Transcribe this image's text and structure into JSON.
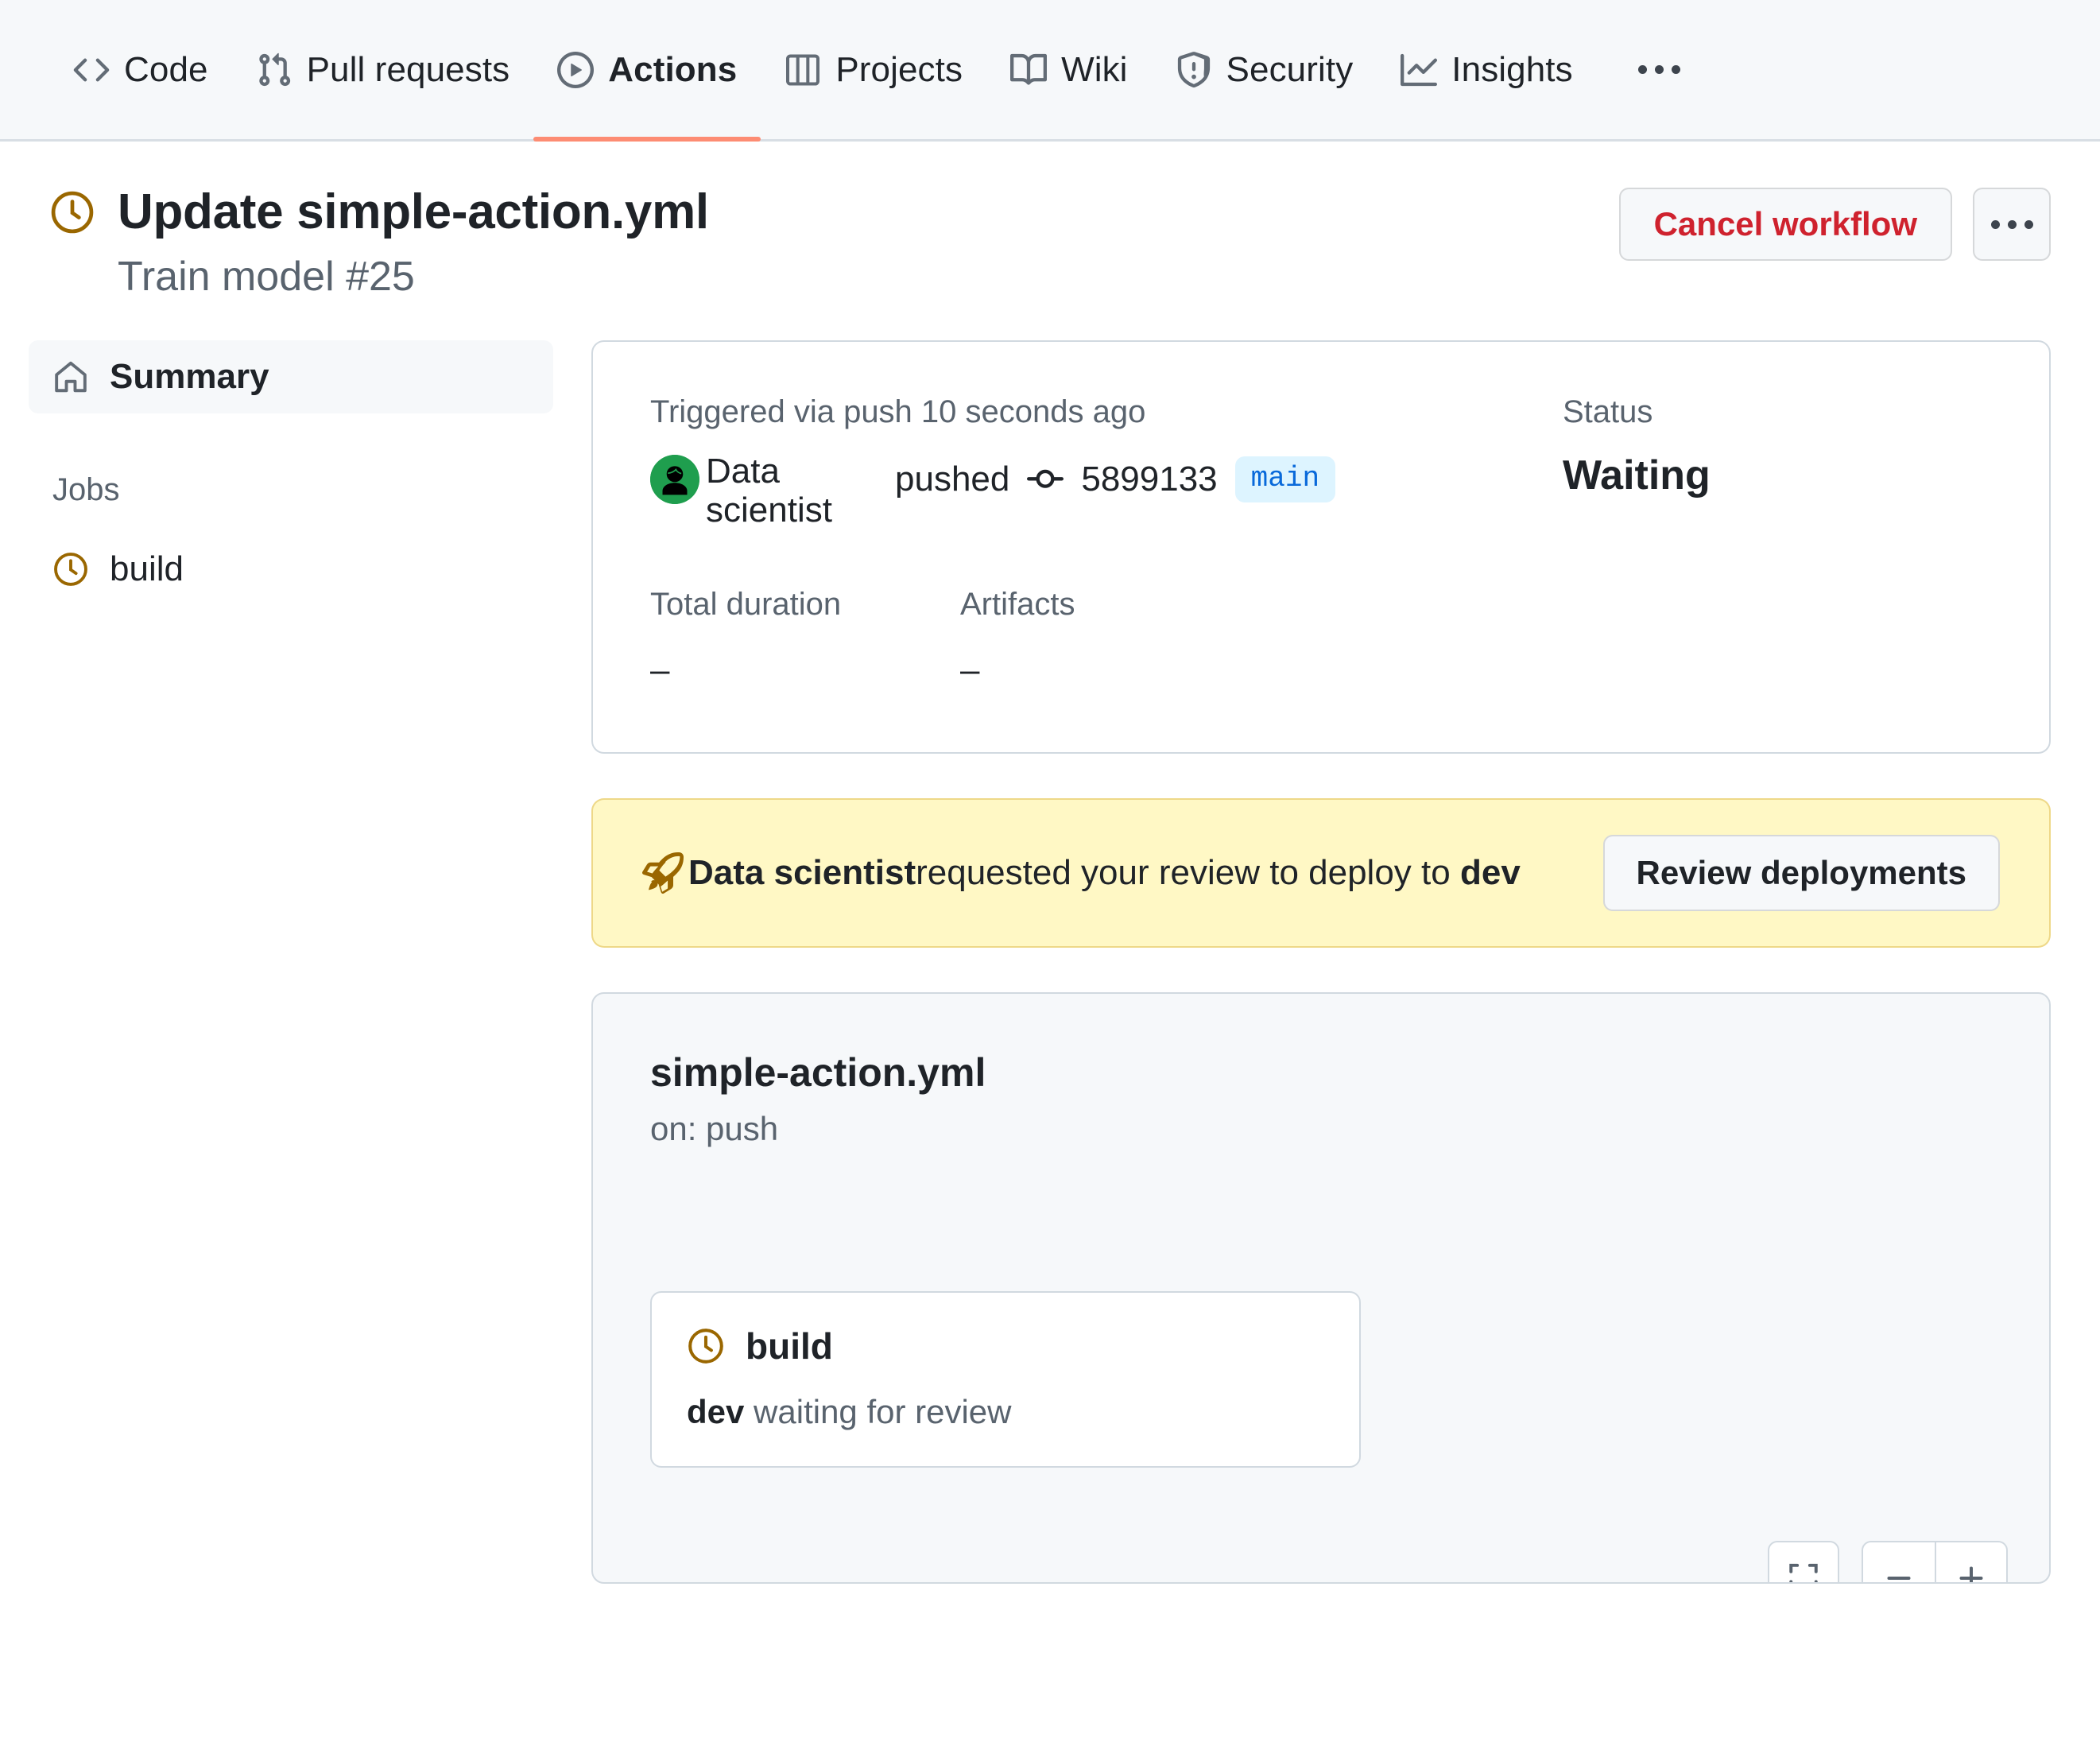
{
  "repo_nav": {
    "items": [
      {
        "label": "Code",
        "icon": "code-icon",
        "active": false
      },
      {
        "label": "Pull requests",
        "icon": "git-pull-request-icon",
        "active": false
      },
      {
        "label": "Actions",
        "icon": "play-circle-icon",
        "active": true
      },
      {
        "label": "Projects",
        "icon": "table-icon",
        "active": false
      },
      {
        "label": "Wiki",
        "icon": "book-icon",
        "active": false
      },
      {
        "label": "Security",
        "icon": "shield-alert-icon",
        "active": false
      },
      {
        "label": "Insights",
        "icon": "graph-icon",
        "active": false
      }
    ],
    "overflow_label": "More"
  },
  "header": {
    "status_icon": "clock-icon",
    "title": "Update simple-action.yml",
    "subtitle": "Train model #25",
    "cancel_label": "Cancel workflow",
    "more_label": "More options"
  },
  "sidebar": {
    "summary_label": "Summary",
    "summary_icon": "home-icon",
    "jobs_heading": "Jobs",
    "jobs": [
      {
        "label": "build",
        "status_icon": "clock-icon"
      }
    ]
  },
  "summary": {
    "triggered_label": "Triggered via push 10 seconds ago",
    "actor": "Data scientist",
    "action_verb": "pushed",
    "commit_icon": "git-commit-icon",
    "commit_sha": "5899133",
    "branch": "main",
    "status_label": "Status",
    "status_value": "Waiting",
    "duration_label": "Total duration",
    "duration_value": "–",
    "artifacts_label": "Artifacts",
    "artifacts_value": "–"
  },
  "review_banner": {
    "icon": "rocket-icon",
    "actor": "Data scientist",
    "message": "requested your review to deploy to",
    "environment": "dev",
    "button_label": "Review deployments",
    "background_color": "#fff8c5"
  },
  "workflow_graph": {
    "file_name": "simple-action.yml",
    "trigger": "on: push",
    "nodes": [
      {
        "name": "build",
        "status_icon": "clock-icon",
        "environment": "dev",
        "status_text": "waiting for review"
      }
    ],
    "controls": {
      "fullscreen_label": "Fit to screen",
      "zoom_out_label": "Zoom out",
      "zoom_in_label": "Zoom in"
    }
  },
  "colors": {
    "pending": "#9a6700",
    "danger": "#cf222e",
    "accent": "#0969da",
    "active_tab_underline": "#fd8c73",
    "avatar": "#1f9e4e"
  }
}
